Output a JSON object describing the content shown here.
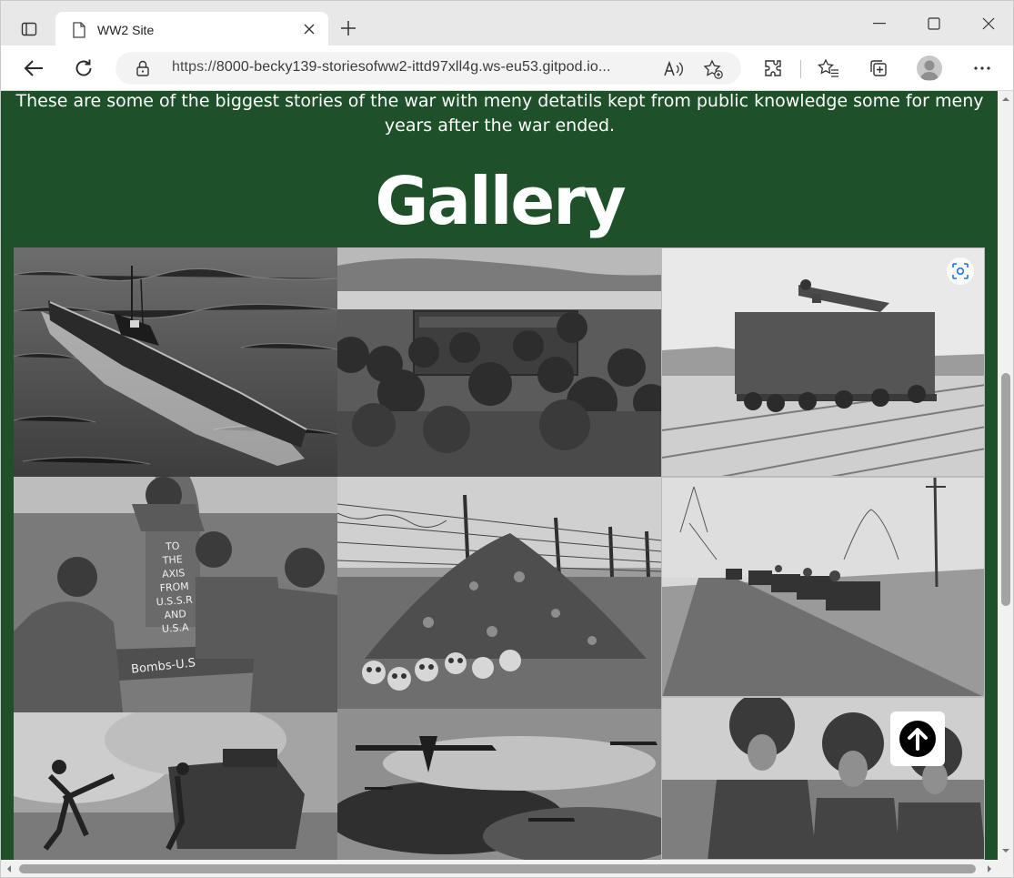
{
  "browser": {
    "tab_title": "WW2 Site",
    "url_prefix": "https://",
    "url_host": "8000-becky139-storiesofww2-ittd97xll4g.ws-eu53.gitpod.io...",
    "address_icons": [
      "read-aloud-icon",
      "add-favorite-icon"
    ],
    "toolbar_icons": [
      "extensions-icon",
      "favorites-icon",
      "collections-icon",
      "profile-avatar",
      "more-menu-icon"
    ]
  },
  "page": {
    "intro_text": "These are some of the biggest stories of the war with meny detatils kept from public knowledge some for meny years after the war ended.",
    "gallery_heading": "Gallery",
    "background_color": "#1e5129",
    "bomb_text_1": "TO THE AXIS FROM U.S.S.R AND U.S.A",
    "bomb_text_2": "Bombs-U.S"
  },
  "gallery": {
    "images": [
      {
        "name": "submarine-photo",
        "subject": "submarine"
      },
      {
        "name": "landing-craft-photo",
        "subject": "soldiers in landing craft"
      },
      {
        "name": "railway-gun-photo",
        "subject": "railway gun"
      },
      {
        "name": "soldiers-with-bombs-photo",
        "subject": "soldiers with bombs"
      },
      {
        "name": "barbed-wire-skulls-photo",
        "subject": "pile of skulls behind barbed wire"
      },
      {
        "name": "tank-column-photo",
        "subject": "tank column on road"
      },
      {
        "name": "soldiers-tank-smoke-photo",
        "subject": "soldiers charging by tank"
      },
      {
        "name": "bombers-photo",
        "subject": "bombers in flight"
      },
      {
        "name": "camouflaged-soldiers-photo",
        "subject": "camouflaged soldiers"
      }
    ]
  }
}
